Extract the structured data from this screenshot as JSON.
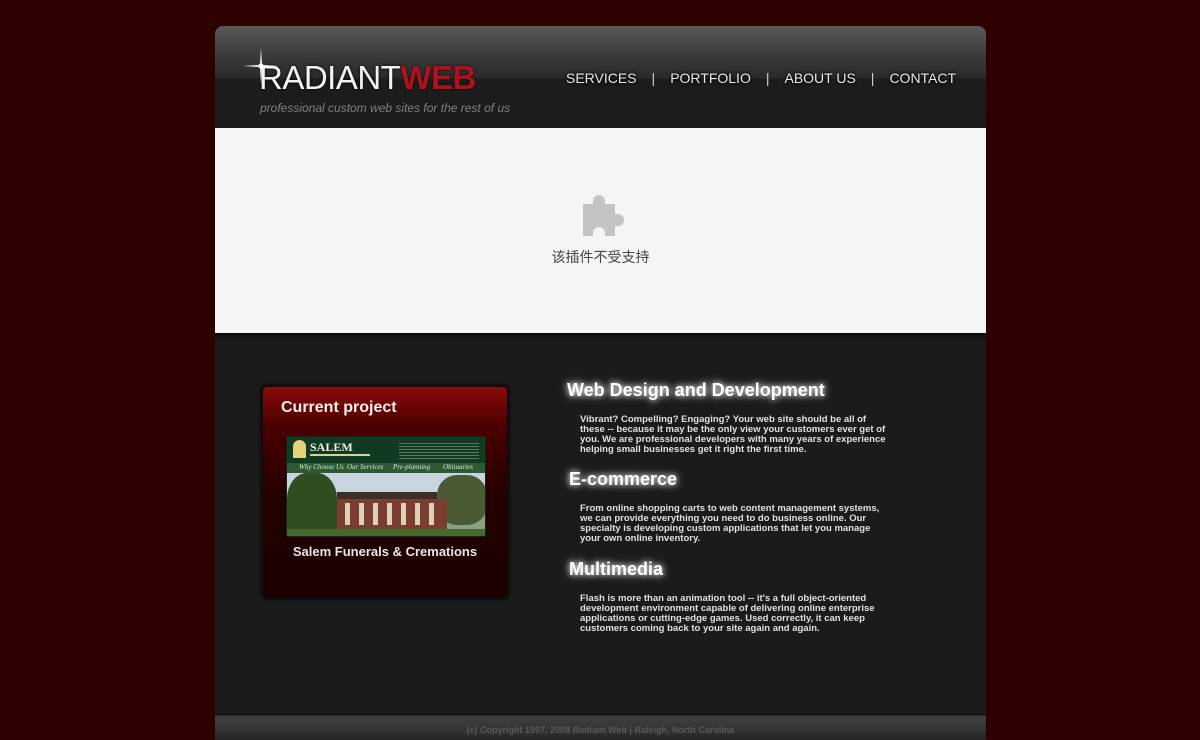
{
  "header": {
    "logo_part1": "RADIANT",
    "logo_part2": "WEB",
    "tagline": "professional custom web sites for the rest of us"
  },
  "nav": {
    "items": [
      {
        "label": "SERVICES"
      },
      {
        "label": "PORTFOLIO"
      },
      {
        "label": "ABOUT US"
      },
      {
        "label": "CONTACT"
      }
    ],
    "separator": "|"
  },
  "plugin": {
    "message": "该插件不受支持",
    "icon": "puzzle-piece-icon"
  },
  "project": {
    "title": "Current project",
    "caption": "Salem Funerals & Cremations",
    "thumb": {
      "name": "SALEM",
      "menu": [
        "Why Choose Us",
        "Our Services",
        "Pre-planning",
        "Obituaries"
      ]
    }
  },
  "sections": [
    {
      "title": "Web Design and Development",
      "body": "Vibrant? Compelling? Engaging? Your web site should be all of these -- because it may be the only view your customers ever get of you. We are professional developers with many years of experience helping small businesses get it right the first time."
    },
    {
      "title": "E-commerce",
      "body": "From online shopping carts to web content management systems, we can provide everything you need to do business online. Our specialty is developing custom applications that let you manage your own online inventory."
    },
    {
      "title": "Multimedia",
      "body": "Flash is more than an animation tool -- it's a full object-oriented development environment capable of delivering online enterprise applications or cutting-edge games. Used correctly, it can keep customers coming back to your site again and again."
    }
  ],
  "footer": {
    "text": "(c) Copyright 1997, 2008 Radiant Web | Raleigh, North Carolina"
  },
  "colors": {
    "page_bg": "#2e0000",
    "brand_red": "#b0121a",
    "panel_bg": "#1b1b1b"
  }
}
